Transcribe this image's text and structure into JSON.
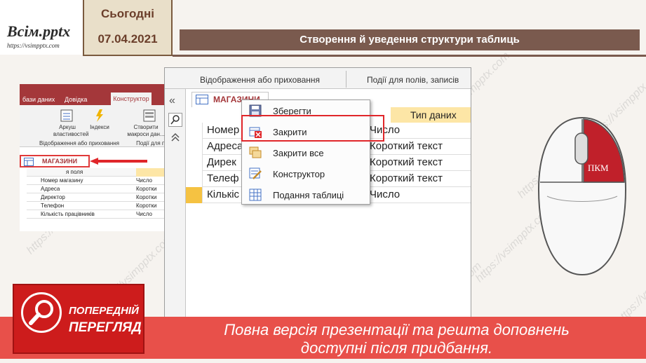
{
  "logo": {
    "name": "Всім.pptx",
    "url": "https://vsimpptx.com"
  },
  "header": {
    "today": "Сьогодні",
    "date": "07.04.2021",
    "title": "Створення й уведення структури таблиць"
  },
  "left_screenshot": {
    "tabs": [
      "бази даних",
      "Довідка"
    ],
    "active_tab": "Конструктор",
    "ribbon": {
      "sheet_label": "Аркуш властивостей",
      "indexes_label": "Індекси",
      "macros_label": "Створити макроси дан...",
      "group1": "Відображення або приховання",
      "group2": "Події для п..."
    },
    "table_tab": "МАГАЗИНИ",
    "header_name": "я поля",
    "header_type": "Т",
    "rows": [
      {
        "name": "Номер магазину",
        "type": "Число"
      },
      {
        "name": "Адреса",
        "type": "Коротки"
      },
      {
        "name": "Директор",
        "type": "Коротки"
      },
      {
        "name": "Телефон",
        "type": "Коротки"
      },
      {
        "name": "Кількість працівників",
        "type": "Число"
      }
    ]
  },
  "main_window": {
    "ribbon_group1": "Відображення або приховання",
    "ribbon_group2": "Події для полів, записів",
    "nav_collapse": "«",
    "table_tab": "МАГАЗИНИ",
    "col_type_header": "Тип даних",
    "rows": [
      {
        "name": "Номер",
        "type": "Число"
      },
      {
        "name": "Адреса",
        "type": "Короткий текст"
      },
      {
        "name": "Дирек",
        "type": "Короткий текст"
      },
      {
        "name": "Телеф",
        "type": "Короткий текст"
      },
      {
        "name": "Кількіс",
        "type": "Число"
      }
    ]
  },
  "context_menu": {
    "items": [
      {
        "label": "Зберегти",
        "icon": "save-icon"
      },
      {
        "label": "Закрити",
        "icon": "close-table-icon"
      },
      {
        "label": "Закрити все",
        "icon": "close-all-icon"
      },
      {
        "label": "Конструктор",
        "icon": "design-view-icon"
      },
      {
        "label": "Подання таблиці",
        "icon": "datasheet-view-icon"
      }
    ]
  },
  "mouse": {
    "label": "ПКМ"
  },
  "preview": {
    "line1": "ПОПЕРЕДНІЙ",
    "line2": "ПЕРЕГЛЯД"
  },
  "banner": {
    "line1": "Повна версія презентації та решта доповнень",
    "line2": "доступні після придбання."
  },
  "watermark": "https://vsimpptx.com",
  "colors": {
    "accent": "#a4373a",
    "banner": "#e8504a",
    "highlight": "#e0262a",
    "title_bar": "#7a5a4e"
  }
}
